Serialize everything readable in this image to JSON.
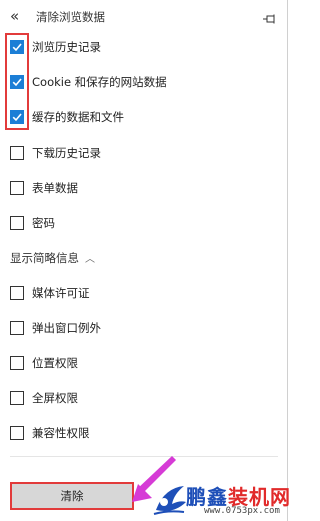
{
  "header": {
    "back_icon": "chevron-double-left-icon",
    "title": "清除浏览数据",
    "pin_icon": "pin-icon"
  },
  "options": [
    {
      "label": "浏览历史记录",
      "checked": true
    },
    {
      "label": "Cookie 和保存的网站数据",
      "checked": true
    },
    {
      "label": "缓存的数据和文件",
      "checked": true
    },
    {
      "label": "下载历史记录",
      "checked": false
    },
    {
      "label": "表单数据",
      "checked": false
    },
    {
      "label": "密码",
      "checked": false
    }
  ],
  "advanced": {
    "toggle_label": "显示简略信息",
    "chevron_icon": "chevron-up-icon",
    "options": [
      {
        "label": "媒体许可证",
        "checked": false
      },
      {
        "label": "弹出窗口例外",
        "checked": false
      },
      {
        "label": "位置权限",
        "checked": false
      },
      {
        "label": "全屏权限",
        "checked": false
      },
      {
        "label": "兼容性权限",
        "checked": false
      }
    ]
  },
  "footer": {
    "clear_label": "清除"
  },
  "watermark": {
    "brand_part1": "鹏鑫",
    "brand_part2": "装机网",
    "url": "www.0753px.com",
    "brand_colors": {
      "blue": "#1e4fb8",
      "red": "#e12a2a"
    }
  },
  "colors": {
    "checkbox_checked": "#1c7ed6",
    "annotation": "#e23b3b",
    "button_bg": "#d7d7d7"
  }
}
